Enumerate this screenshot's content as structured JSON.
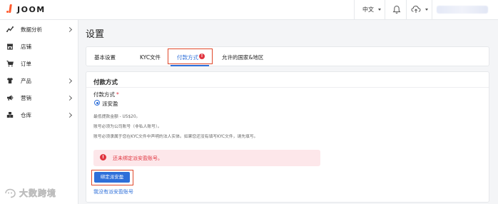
{
  "app": {
    "logo_text": "JOOM"
  },
  "topbar": {
    "language": "中文"
  },
  "sidebar": {
    "items": [
      {
        "label": "数据分析",
        "icon": "trend-icon",
        "has_children": true
      },
      {
        "label": "店铺",
        "icon": "store-icon",
        "has_children": false
      },
      {
        "label": "订单",
        "icon": "cart-icon",
        "has_children": false
      },
      {
        "label": "产品",
        "icon": "shirt-icon",
        "has_children": true
      },
      {
        "label": "营销",
        "icon": "megaphone-icon",
        "has_children": true
      },
      {
        "label": "仓库",
        "icon": "warehouse-icon",
        "has_children": true
      }
    ]
  },
  "page": {
    "title": "设置"
  },
  "tabs": [
    {
      "label": "基本设置",
      "active": false
    },
    {
      "label": "KYC文件",
      "active": false
    },
    {
      "label": "付款方式",
      "active": true,
      "badge": "!"
    },
    {
      "label": "允许的国家&地区",
      "active": false
    }
  ],
  "payment": {
    "section_title": "付款方式",
    "field_label": "付款方式",
    "required_mark": "*",
    "option_label": "派安盈",
    "notes": [
      "最低提款金额 - US$20。",
      "账号必须为公司账号（非私人账号）。",
      "账号必须隶属于您在KYC文件中声明的法人实体。如果您还没有填写KYC文件，请先填写。"
    ],
    "alert_icon": "!",
    "alert_text": "还未绑定派安盈账号。",
    "bind_button": "绑定派安盈",
    "no_account_link": "我没有派安盈账号"
  },
  "watermark": {
    "text": "大数跨境"
  },
  "colors": {
    "accent": "#2e6fd9",
    "alert": "#e0343f",
    "highlight": "#e0482a",
    "logo": "#ff5a2c"
  }
}
